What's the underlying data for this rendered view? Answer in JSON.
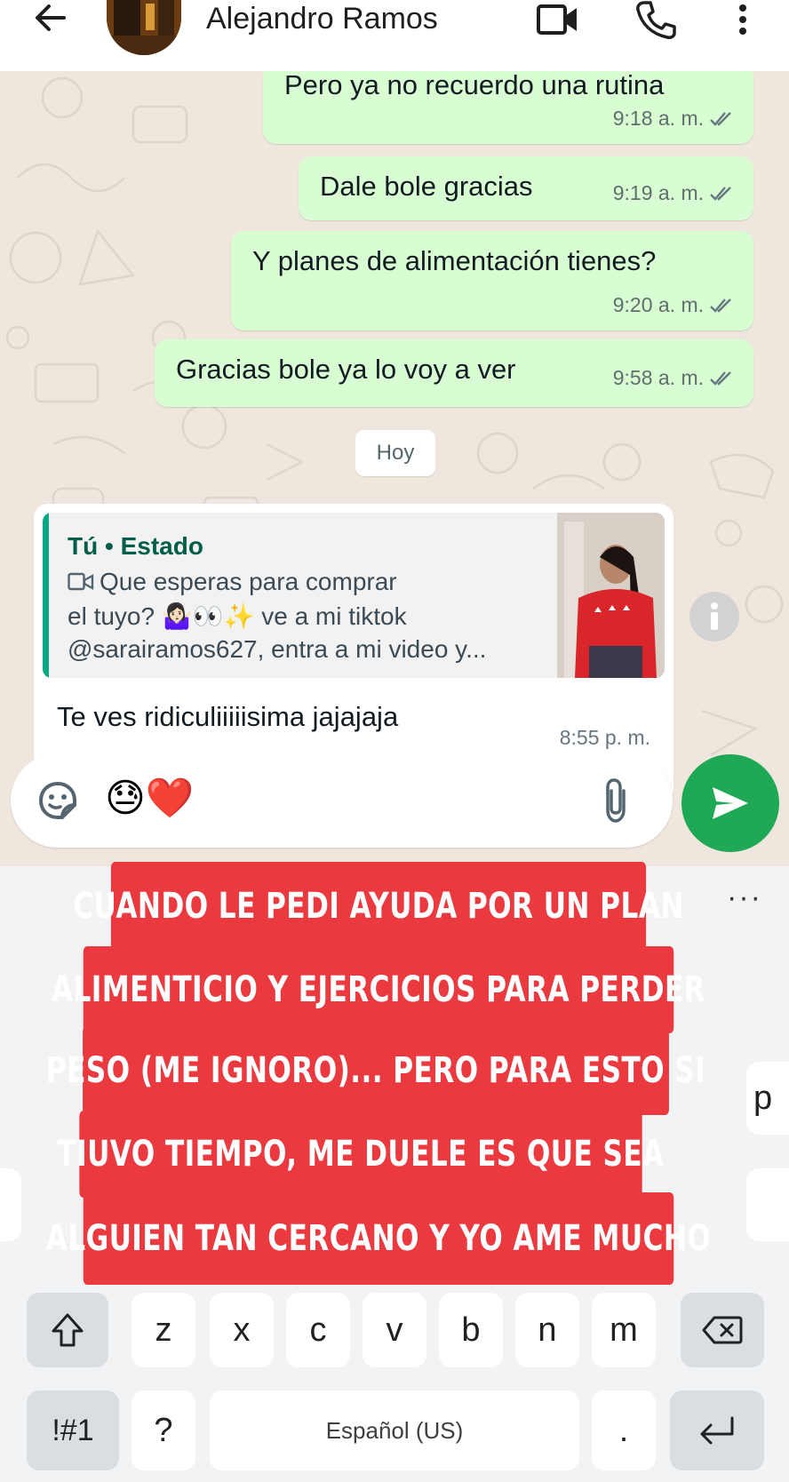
{
  "header": {
    "contact_name": "Alejandro Ramos",
    "back_icon": "arrow-left-icon",
    "video_icon": "video-call-icon",
    "call_icon": "phone-icon",
    "menu_icon": "more-vertical-icon"
  },
  "messages_out": [
    {
      "text": "Pero ya no recuerdo una rutina",
      "time": "9:18 a. m."
    },
    {
      "text": "Dale bole gracias",
      "time": "9:19 a. m."
    },
    {
      "text": "Y planes de alimentación tienes?",
      "time": "9:20 a. m."
    },
    {
      "text": "Gracias bole ya lo voy a ver",
      "time": "9:58 a. m."
    }
  ],
  "day_divider": "Hoy",
  "incoming": {
    "quote_author": "Tú • Estado",
    "quote_line1": "Que esperas para comprar",
    "quote_line2": "el tuyo? 🤷🏻‍♀️👀✨ ve a mi tiktok",
    "quote_line3": "@sarairamos627, entra a mi video y...",
    "text": "Te ves ridiculiiiiisima jajajaja",
    "time": "8:55 p. m."
  },
  "composer": {
    "emojis": "😓❤️",
    "sticker_icon": "sticker-icon",
    "attach_icon": "paperclip-icon",
    "send_icon": "send-icon"
  },
  "keyboard": {
    "more": "···",
    "bottom_row": [
      "z",
      "x",
      "c",
      "v",
      "b",
      "n",
      "m"
    ],
    "symbols": "!#1",
    "question": "?",
    "space": "Español (US)",
    "period": ".",
    "partial_right": "p"
  },
  "overlay_caption": [
    "CUANDO LE PEDI AYUDA POR UN PLAN",
    "ALIMENTICIO Y EJERCICIOS PARA PERDER",
    "PESO (ME IGNORO)... PERO PARA ESTO SI",
    "TIUVO TIEMPO, ME DUELE ES QUE SEA",
    "ALGUIEN TAN CERCANO Y YO AME MUCHO"
  ],
  "colors": {
    "outgoing_bubble": "#d9fdd3",
    "send_button": "#1fa855",
    "caption_red": "#ea3a3f",
    "chat_bg": "#efe7de"
  }
}
